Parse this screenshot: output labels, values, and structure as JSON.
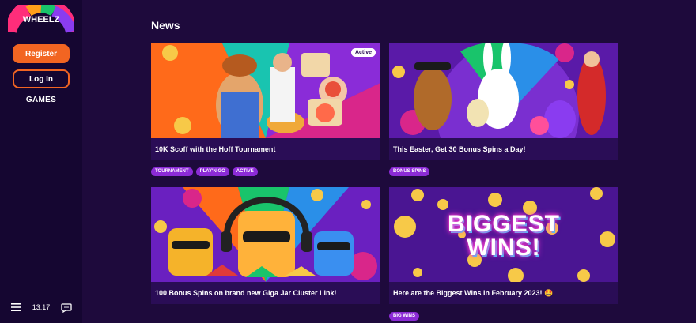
{
  "brand": {
    "logo_text": "WHEELZ",
    "accent": "#f26522"
  },
  "sidebar": {
    "register_label": "Register",
    "login_label": "Log In",
    "games_label": "GAMES",
    "time": "13:17"
  },
  "main": {
    "title": "News",
    "cards": [
      {
        "title": "10K Scoff with the Hoff Tournament",
        "badge": "Active",
        "tags": [
          "TOURNAMENT",
          "PLAY'N GO",
          "ACTIVE"
        ]
      },
      {
        "title": "This Easter, Get 30 Bonus Spins a Day!",
        "tags": [
          "BONUS SPINS"
        ]
      },
      {
        "title": "100 Bonus Spins on brand new Giga Jar Cluster Link!",
        "tags": []
      },
      {
        "title": "Here are the Biggest Wins in February 2023! 🤩",
        "image_text": "BIGGEST WINS!",
        "tags": [
          "BIG WINS"
        ]
      }
    ]
  }
}
